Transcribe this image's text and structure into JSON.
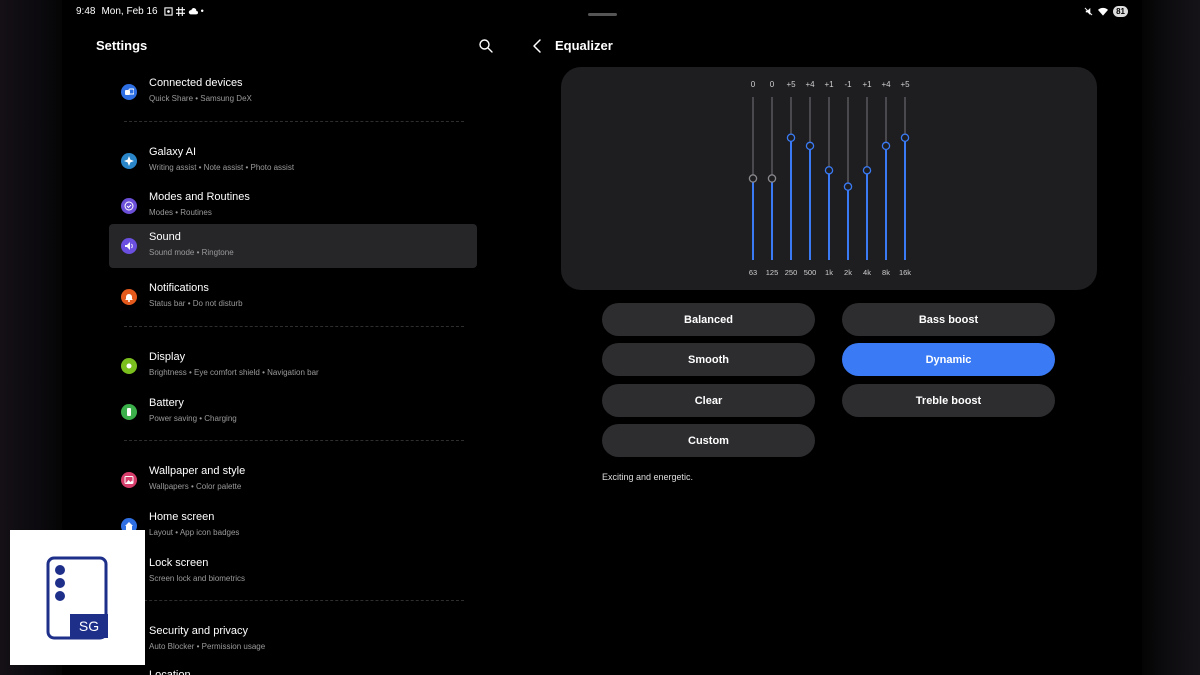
{
  "status": {
    "time": "9:48",
    "date": "Mon, Feb 16",
    "battery": "81"
  },
  "settings": {
    "title": "Settings",
    "items": [
      {
        "title": "Connected devices",
        "subtitle": "Quick Share  •  Samsung DeX",
        "icon": "link-icon",
        "color": "#2f6fe4"
      },
      {
        "title": "Galaxy AI",
        "subtitle": "Writing assist  •  Note assist  •  Photo assist",
        "icon": "sparkle-icon",
        "color": "#2a86c9"
      },
      {
        "title": "Modes and Routines",
        "subtitle": "Modes  •  Routines",
        "icon": "check-circle-icon",
        "color": "#6b4fd8"
      },
      {
        "title": "Sound",
        "subtitle": "Sound mode  •  Ringtone",
        "icon": "speaker-icon",
        "color": "#6a4fe0"
      },
      {
        "title": "Notifications",
        "subtitle": "Status bar  •  Do not disturb",
        "icon": "bell-icon",
        "color": "#e45a1c"
      },
      {
        "title": "Display",
        "subtitle": "Brightness  •  Eye comfort shield  •  Navigation bar",
        "icon": "sun-icon",
        "color": "#7bbf1e"
      },
      {
        "title": "Battery",
        "subtitle": "Power saving  •  Charging",
        "icon": "battery-icon",
        "color": "#3bb04a"
      },
      {
        "title": "Wallpaper and style",
        "subtitle": "Wallpapers  •  Color palette",
        "icon": "image-icon",
        "color": "#d63d6a"
      },
      {
        "title": "Home screen",
        "subtitle": "Layout  •  App icon badges",
        "icon": "home-icon",
        "color": "#2f6fe4"
      },
      {
        "title": "Lock screen",
        "subtitle": "Screen lock and biometrics",
        "icon": "lock-icon",
        "color": "#2f6fe4"
      },
      {
        "title": "Security and privacy",
        "subtitle": "Auto Blocker  •  Permission usage",
        "icon": "shield-icon",
        "color": "#6a4fe0"
      },
      {
        "title": "Location",
        "subtitle": "",
        "icon": "pin-icon",
        "color": "#3a7bf5"
      }
    ]
  },
  "equalizer": {
    "title": "Equalizer",
    "bands": [
      {
        "freq": "63",
        "label": "0",
        "value": 0
      },
      {
        "freq": "125",
        "label": "0",
        "value": 0
      },
      {
        "freq": "250",
        "label": "+5",
        "value": 5
      },
      {
        "freq": "500",
        "label": "+4",
        "value": 4
      },
      {
        "freq": "1k",
        "label": "+1",
        "value": 1
      },
      {
        "freq": "2k",
        "label": "-1",
        "value": -1
      },
      {
        "freq": "4k",
        "label": "+1",
        "value": 1
      },
      {
        "freq": "8k",
        "label": "+4",
        "value": 4
      },
      {
        "freq": "16k",
        "label": "+5",
        "value": 5
      }
    ],
    "range": [
      -10,
      10
    ],
    "presets": {
      "balanced": "Balanced",
      "bass_boost": "Bass boost",
      "smooth": "Smooth",
      "dynamic": "Dynamic",
      "clear": "Clear",
      "treble_boost": "Treble boost",
      "custom": "Custom"
    },
    "selected_preset": "Dynamic",
    "description": "Exciting and energetic."
  },
  "colors": {
    "accent": "#3a7bf5",
    "active_row": "#262629",
    "card": "#1e1e21"
  }
}
